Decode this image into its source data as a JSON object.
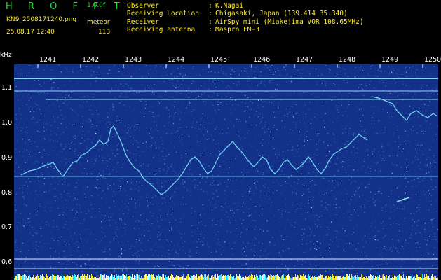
{
  "header": {
    "brand": "H R O F F T",
    "version": "1.0.0f",
    "filename": "KN9_2508171240.png",
    "mode": "meteor",
    "datetime": "25.08.17 12:40",
    "count": "113"
  },
  "info": [
    {
      "label": "Observer",
      "value": "K.Nagai"
    },
    {
      "label": "Receiving Location",
      "value": "Chigasaki, Japan (139.414 35.340)"
    },
    {
      "label": "Receiver",
      "value": "AirSpy mini (Miakejima VOR 108.65MHz)"
    },
    {
      "label": "Receiving antenna",
      "value": "Maspro FM-3"
    }
  ],
  "axes": {
    "y_unit": "kHz",
    "x_ticks": [
      "1241",
      "1242",
      "1243",
      "1244",
      "1245",
      "1246",
      "1247",
      "1248",
      "1249",
      "1250"
    ],
    "y_ticks": [
      "1.1",
      "1.0",
      "0.9",
      "0.8",
      "0.7",
      "0.6"
    ]
  },
  "colors": {
    "background": "#000000",
    "spectrogram_bg": "#14318a",
    "signal": "#6fe0ff",
    "noise": "#3f8fe0",
    "header_green": "#22dd33",
    "header_yellow": "#ffee22",
    "label": "#ffffff"
  }
}
